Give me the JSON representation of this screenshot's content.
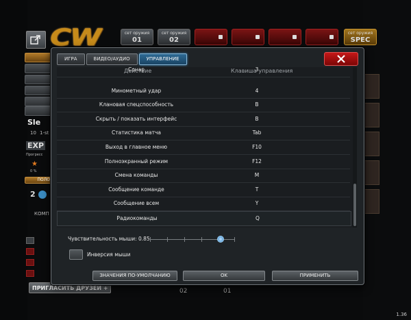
{
  "lobby": {
    "weapon_slots": [
      {
        "label": "сет оружия",
        "num": "01",
        "style": "grey"
      },
      {
        "label": "сет оружия",
        "num": "02",
        "style": "grey"
      },
      {
        "label": "",
        "num": "",
        "style": "red"
      },
      {
        "label": "",
        "num": "",
        "style": "red"
      },
      {
        "label": "",
        "num": "",
        "style": "red"
      },
      {
        "label": "",
        "num": "",
        "style": "red"
      },
      {
        "label": "сет оружия",
        "num": "SPEC",
        "style": "gold"
      }
    ],
    "logo": "CW",
    "player_name": "Sle",
    "player_level": "10",
    "player_rank_suffix": "1-st",
    "exp_label": "EXP",
    "progress_label": "Прогресс",
    "progress_value": "0 %",
    "side_count": "2",
    "side_label": "ПОЛО",
    "comp_label": "КОМП",
    "invite_button": "ПРИГЛАСИТЬ ДРУЗЕЙ",
    "bottom_tab_1": "02",
    "bottom_tab_2": "01",
    "version": "1.36"
  },
  "dialog": {
    "tabs": [
      {
        "label": "ИГРА",
        "active": false
      },
      {
        "label": "ВИДЕО/АУДИО",
        "active": false
      },
      {
        "label": "УПРАВЛЕНИЕ",
        "active": true
      }
    ],
    "close_icon": "close-x-icon",
    "headers": {
      "action": "Действие",
      "key": "Клавиша управления"
    },
    "bindings": [
      {
        "action": "Сонар",
        "key": "3"
      },
      {
        "action": "Минометный удар",
        "key": "4"
      },
      {
        "action": "Клановая спецспособность",
        "key": "B"
      },
      {
        "action": "Скрыть / показать интерфейс",
        "key": "B"
      },
      {
        "action": "Статистика матча",
        "key": "Tab"
      },
      {
        "action": "Выход в главное меню",
        "key": "F10"
      },
      {
        "action": "Полноэкранный режим",
        "key": "F12"
      },
      {
        "action": "Смена команды",
        "key": "M"
      },
      {
        "action": "Сообщение команде",
        "key": "T"
      },
      {
        "action": "Сообщение всем",
        "key": "Y"
      },
      {
        "action": "Радиокоманды",
        "key": "Q"
      }
    ],
    "mouse_sensitivity": {
      "label": "Чувствительность мыши:",
      "value": "0.85",
      "fraction": 0.85
    },
    "invert_mouse": {
      "label": "Инверсия мыши",
      "checked": false
    },
    "buttons": {
      "defaults": "Значения по-умолчанию",
      "ok": "OK",
      "apply": "Применить"
    }
  },
  "colors": {
    "accent": "#2e6a94",
    "close": "#c41818",
    "gold": "#c68a1a"
  }
}
